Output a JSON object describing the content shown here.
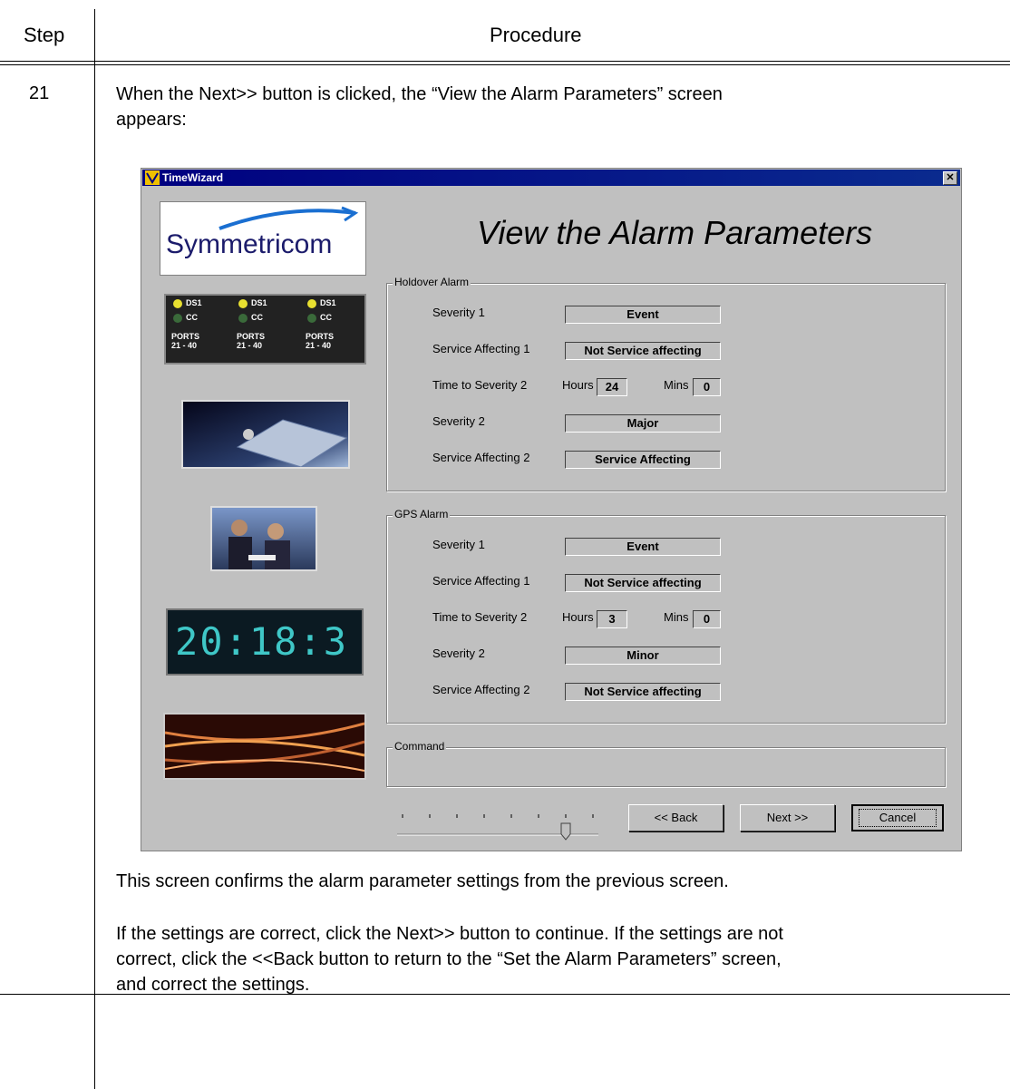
{
  "table": {
    "step_header": "Step",
    "procedure_header": "Procedure",
    "step_number": "21"
  },
  "intro_text": [
    "When the Next>> button is clicked, the “View the Alarm Parameters” screen",
    "appears:"
  ],
  "window": {
    "title": "TimeWizard",
    "close_glyph": "✕",
    "logo_text": "Symmetricom",
    "heading": "View the Alarm Parameters",
    "panel_labels": [
      "DS1",
      "CC",
      "PORTS",
      "21 - 40"
    ],
    "clock_text": "20:18:3",
    "holdover": {
      "title": "Holdover Alarm",
      "severity1_label": "Severity 1",
      "severity1_value": "Event",
      "service1_label": "Service Affecting 1",
      "service1_value": "Not Service affecting",
      "time_label": "Time to Severity 2",
      "hours_label": "Hours",
      "hours_value": "24",
      "mins_label": "Mins",
      "mins_value": "0",
      "severity2_label": "Severity 2",
      "severity2_value": "Major",
      "service2_label": "Service Affecting 2",
      "service2_value": "Service Affecting"
    },
    "gps": {
      "title": "GPS Alarm",
      "severity1_label": "Severity 1",
      "severity1_value": "Event",
      "service1_label": "Service Affecting 1",
      "service1_value": "Not Service affecting",
      "time_label": "Time to Severity 2",
      "hours_label": "Hours",
      "hours_value": "3",
      "mins_label": "Mins",
      "mins_value": "0",
      "severity2_label": "Severity 2",
      "severity2_value": "Minor",
      "service2_label": "Service Affecting 2",
      "service2_value": "Not Service affecting"
    },
    "command_title": "Command",
    "slider": {
      "ticks": 8,
      "position_index": 6
    },
    "buttons": {
      "back": "<< Back",
      "next": "Next >>",
      "cancel": "Cancel"
    }
  },
  "after_text": [
    "This screen confirms the alarm parameter settings from the previous screen.",
    "If the settings are correct, click the Next>> button to continue. If the settings are not",
    "correct, click the <<Back button to return to the “Set the Alarm Parameters” screen,",
    "and correct the settings."
  ],
  "colors": {
    "titlebar": "#000080",
    "dialog": "#c0c0c0",
    "clock": "#3fc7c7"
  }
}
